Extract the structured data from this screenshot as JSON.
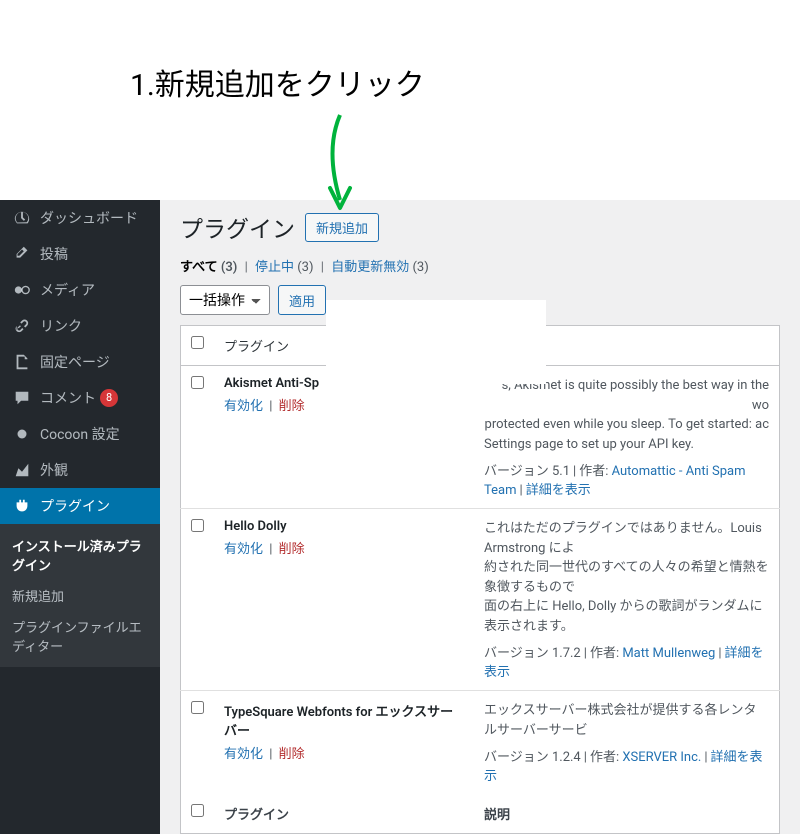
{
  "annotation": {
    "text": "1.新規追加をクリック"
  },
  "sidebar": {
    "items": [
      {
        "label": "ダッシュボード",
        "icon": "dashboard"
      },
      {
        "label": "投稿",
        "icon": "pin"
      },
      {
        "label": "メディア",
        "icon": "media"
      },
      {
        "label": "リンク",
        "icon": "link"
      },
      {
        "label": "固定ページ",
        "icon": "page"
      },
      {
        "label": "コメント",
        "icon": "comment",
        "badge": "8"
      },
      {
        "label": "Cocoon 設定",
        "icon": "dot"
      },
      {
        "label": "外観",
        "icon": "appearance"
      },
      {
        "label": "プラグイン",
        "icon": "plugin",
        "active": true
      }
    ],
    "submenu": [
      {
        "label": "インストール済みプラグイン",
        "current": true
      },
      {
        "label": "新規追加"
      },
      {
        "label": "プラグインファイルエディター"
      }
    ]
  },
  "page": {
    "title": "プラグイン",
    "add_new": "新規追加"
  },
  "filters": {
    "all_label": "すべて",
    "all_count": "(3)",
    "inactive_label": "停止中",
    "inactive_count": "(3)",
    "autoupdate_label": "自動更新無効",
    "autoupdate_count": "(3)"
  },
  "bulk": {
    "placeholder": "一括操作",
    "apply": "適用"
  },
  "columns": {
    "plugin": "プラグイン",
    "description": "説明"
  },
  "plugins": [
    {
      "name": "Akismet Anti-Sp",
      "activate": "有効化",
      "delete": "削除",
      "desc1": "s, Akismet is quite possibly the best way in the wo",
      "desc2": "protected even while you sleep. To get started: ac",
      "desc3": "Settings page to set up your API key.",
      "version_prefix": "バージョン 5.1",
      "author_prefix": "作者:",
      "author": "Automattic - Anti Spam Team",
      "details": "詳細を表示"
    },
    {
      "name": "Hello Dolly",
      "activate": "有効化",
      "delete": "削除",
      "desc1": "これはただのプラグインではありません。Louis Armstrong によ",
      "desc2": "約された同一世代のすべての人々の希望と情熱を象徴するもので",
      "desc3": "面の右上に Hello, Dolly からの歌詞がランダムに表示されます。",
      "version_prefix": "バージョン 1.7.2",
      "author_prefix": "作者:",
      "author": "Matt Mullenweg",
      "details": "詳細を表示"
    },
    {
      "name": "TypeSquare Webfonts for エックスサーバー",
      "activate": "有効化",
      "delete": "削除",
      "desc1": "エックスサーバー株式会社が提供する各レンタルサーバーサービ",
      "version_prefix": "バージョン 1.2.4",
      "author_prefix": "作者:",
      "author": "XSERVER Inc.",
      "details": "詳細を表示"
    }
  ]
}
